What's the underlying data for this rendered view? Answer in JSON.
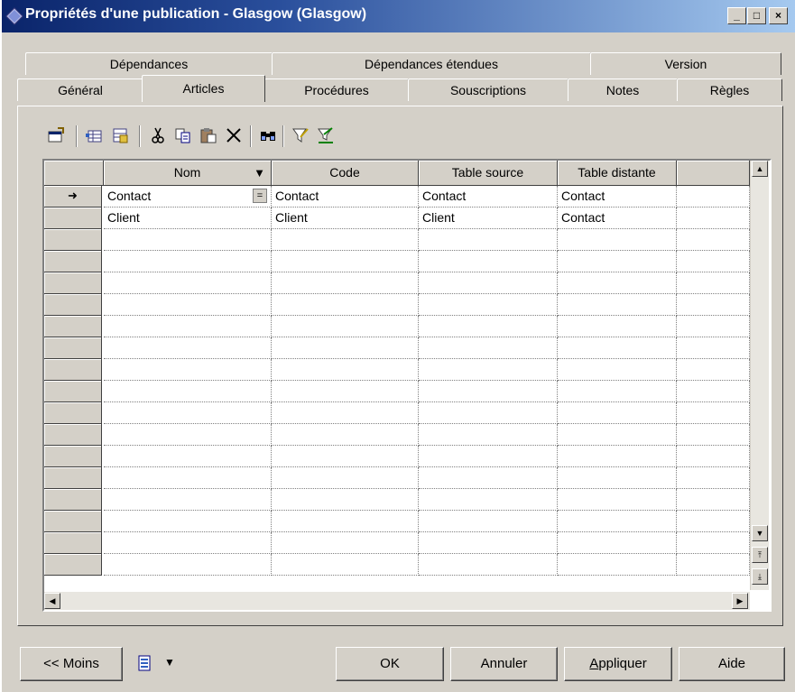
{
  "window": {
    "title": "Propriétés d'une publication - Glasgow (Glasgow)",
    "controls": {
      "minimize": "_",
      "maximize": "□",
      "close": "×"
    }
  },
  "tabs": {
    "back_row": [
      "Dépendances",
      "Dépendances étendues",
      "Version"
    ],
    "front_row": [
      "Général",
      "Articles",
      "Procédures",
      "Souscriptions",
      "Notes",
      "Règles"
    ],
    "active": "Articles"
  },
  "toolbar": {
    "icons": [
      "properties-icon",
      "add-row-icon",
      "insert-row-icon",
      "cut-icon",
      "copy-icon",
      "paste-icon",
      "delete-icon",
      "find-icon",
      "filter-icon",
      "clear-filter-icon"
    ]
  },
  "grid": {
    "columns": [
      "Nom",
      "Code",
      "Table source",
      "Table distante",
      ""
    ],
    "sorted_column_marker": "▼",
    "rows": [
      {
        "indicator": "➜",
        "cells": [
          "Contact",
          "Contact",
          "Contact",
          "Contact",
          ""
        ],
        "edit_button": "="
      },
      {
        "indicator": "",
        "cells": [
          "Client",
          "Client",
          "Client",
          "Contact",
          ""
        ]
      }
    ],
    "empty_rows": 16
  },
  "footer": {
    "less_button": "<< Moins",
    "ok": "OK",
    "cancel": "Annuler",
    "apply": "Appliquer",
    "apply_mnemonic": "A",
    "help": "Aide"
  }
}
